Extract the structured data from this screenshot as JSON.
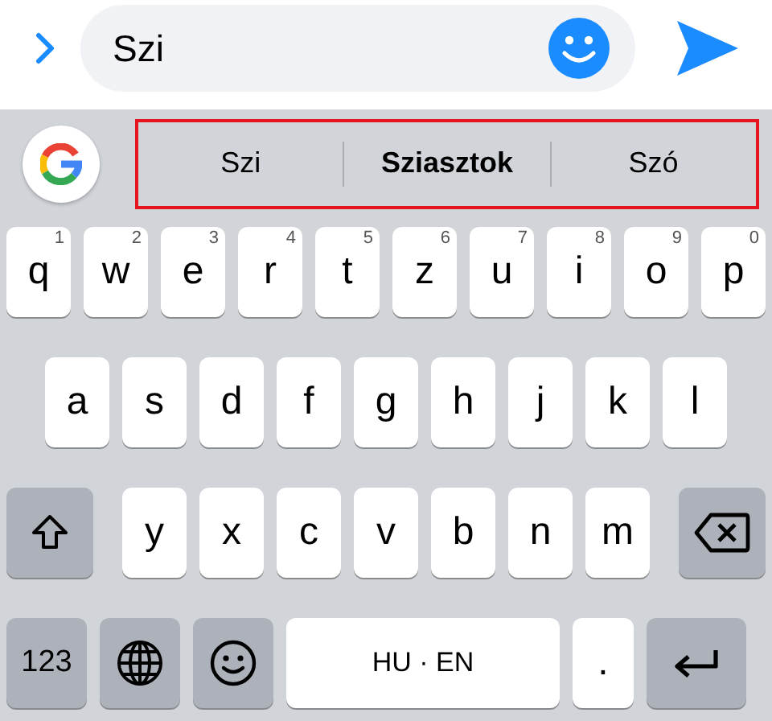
{
  "message_bar": {
    "value": "Szi"
  },
  "suggestions": [
    {
      "label": "Szi",
      "selected": false
    },
    {
      "label": "Sziasztok",
      "selected": true
    },
    {
      "label": "Szó",
      "selected": false
    }
  ],
  "keyboard": {
    "rows": [
      {
        "keys": [
          {
            "kind": "letter",
            "label": "q",
            "hint": "1"
          },
          {
            "kind": "letter",
            "label": "w",
            "hint": "2"
          },
          {
            "kind": "letter",
            "label": "e",
            "hint": "3"
          },
          {
            "kind": "letter",
            "label": "r",
            "hint": "4"
          },
          {
            "kind": "letter",
            "label": "t",
            "hint": "5"
          },
          {
            "kind": "letter",
            "label": "z",
            "hint": "6"
          },
          {
            "kind": "letter",
            "label": "u",
            "hint": "7"
          },
          {
            "kind": "letter",
            "label": "i",
            "hint": "8"
          },
          {
            "kind": "letter",
            "label": "o",
            "hint": "9"
          },
          {
            "kind": "letter",
            "label": "p",
            "hint": "0"
          }
        ]
      },
      {
        "keys": [
          {
            "kind": "letter",
            "label": "a"
          },
          {
            "kind": "letter",
            "label": "s"
          },
          {
            "kind": "letter",
            "label": "d"
          },
          {
            "kind": "letter",
            "label": "f"
          },
          {
            "kind": "letter",
            "label": "g"
          },
          {
            "kind": "letter",
            "label": "h"
          },
          {
            "kind": "letter",
            "label": "j"
          },
          {
            "kind": "letter",
            "label": "k"
          },
          {
            "kind": "letter",
            "label": "l"
          }
        ]
      },
      {
        "keys": [
          {
            "kind": "shift"
          },
          {
            "kind": "letter",
            "label": "y"
          },
          {
            "kind": "letter",
            "label": "x"
          },
          {
            "kind": "letter",
            "label": "c"
          },
          {
            "kind": "letter",
            "label": "v"
          },
          {
            "kind": "letter",
            "label": "b"
          },
          {
            "kind": "letter",
            "label": "n"
          },
          {
            "kind": "letter",
            "label": "m"
          },
          {
            "kind": "backspace"
          }
        ]
      },
      {
        "keys": [
          {
            "kind": "mode",
            "label": "123"
          },
          {
            "kind": "globe"
          },
          {
            "kind": "emoji"
          },
          {
            "kind": "space",
            "label": "HU · EN"
          },
          {
            "kind": "letter",
            "label": "."
          },
          {
            "kind": "return"
          }
        ]
      }
    ]
  }
}
